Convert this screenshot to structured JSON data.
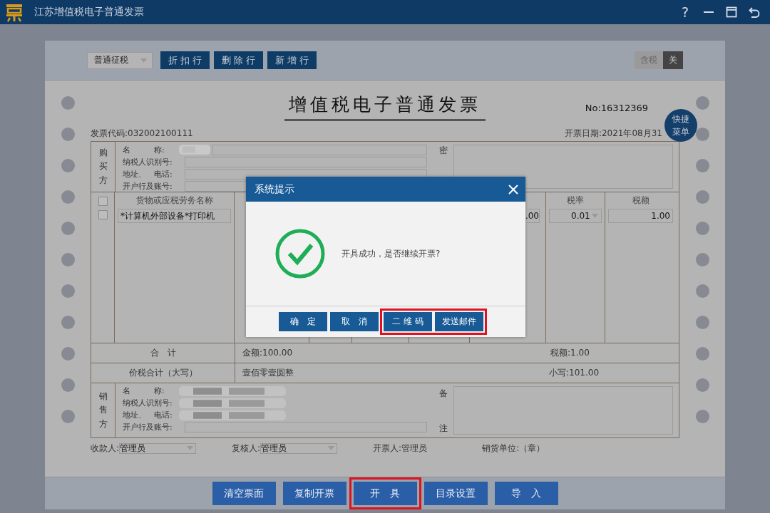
{
  "app": {
    "title": "江苏增值税电子普通发票",
    "help": "?"
  },
  "toolbar": {
    "mode": "普通征税",
    "buttons": [
      "折 扣 行",
      "删 除 行",
      "新 增 行"
    ],
    "tax_toggle": {
      "label": "含税",
      "state": "关",
      "on": false
    }
  },
  "invoice": {
    "title": "增值税电子普通发票",
    "number": "No:16312369",
    "code": "发票代码:032002100111",
    "date": "开票日期:2021年08月31",
    "quick_menu": "快捷菜单",
    "buyer": {
      "label": "购买方",
      "fields": [
        {
          "label": "名　　　称:",
          "redacted": true
        },
        {
          "label": "纳税人识别号:",
          "redacted": false
        },
        {
          "label": "地址、　电话:",
          "redacted": false
        },
        {
          "label": "开户行及账号:",
          "redacted": false
        }
      ],
      "secret_label": "密"
    },
    "items": {
      "header_checked": false,
      "columns": [
        "货物或应税劳务名称",
        "税率",
        "税额"
      ],
      "rows": [
        {
          "checked": false,
          "name": "*计算机外部设备*打印机",
          "amount": ".00",
          "rate": "0.01",
          "tax": "1.00"
        }
      ]
    },
    "total": {
      "label": "合　计",
      "amount": "金额:100.00",
      "tax": "税额:1.00"
    },
    "grand_total": {
      "label": "价税合计（大写）",
      "words": "壹佰零壹圆整",
      "figure": "小写:101.00"
    },
    "seller": {
      "label": "销售方",
      "fields": [
        {
          "label": "名　　　称:",
          "redacted": true
        },
        {
          "label": "纳税人识别号:",
          "redacted": true
        },
        {
          "label": "地址、　电话:",
          "redacted": true
        },
        {
          "label": "开户行及账号:",
          "redacted": false
        }
      ],
      "remark_labels": [
        "备",
        "注"
      ]
    },
    "signatures": {
      "payee": {
        "label": "收款人:",
        "value": "管理员"
      },
      "reviewer": {
        "label": "复核人:",
        "value": "管理员"
      },
      "drawer": "开票人:管理员",
      "seal": "销货单位:（章）"
    }
  },
  "actions": [
    {
      "label": "清空票面",
      "highlighted": false
    },
    {
      "label": "复制开票",
      "highlighted": false
    },
    {
      "label": "开　具",
      "highlighted": true
    },
    {
      "label": "目录设置",
      "highlighted": false
    },
    {
      "label": "导　入",
      "highlighted": false
    }
  ],
  "dialog": {
    "title": "系统提示",
    "message": "开具成功，是否继续开票?",
    "buttons": [
      {
        "label": "确　定",
        "highlighted": false
      },
      {
        "label": "取　消",
        "highlighted": false
      },
      {
        "label": "二 维 码",
        "highlighted": true
      },
      {
        "label": "发送邮件",
        "highlighted": true
      }
    ]
  }
}
